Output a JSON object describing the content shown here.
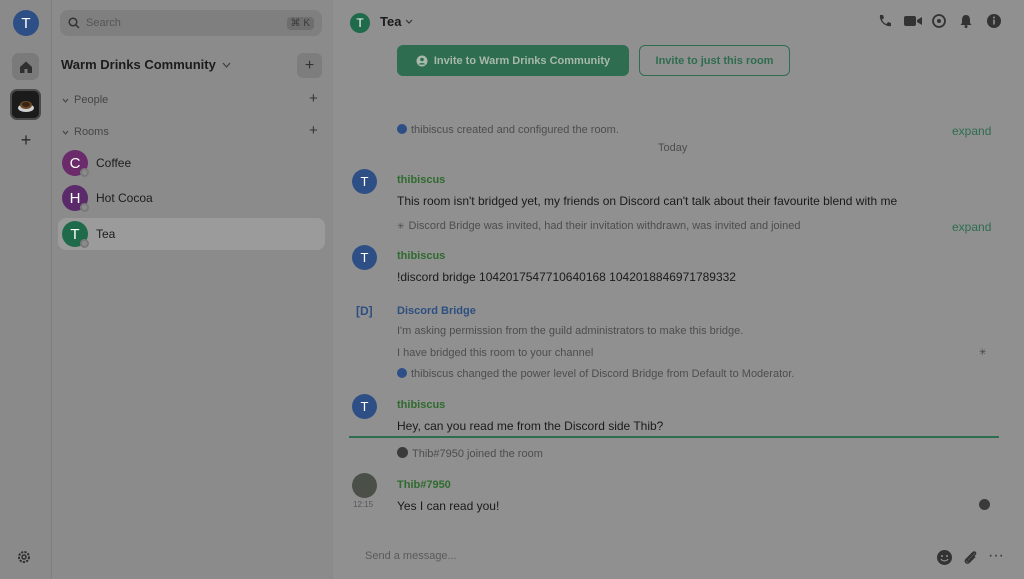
{
  "rail": {
    "user_initial": "T"
  },
  "search": {
    "placeholder": "Search",
    "shortcut": "⌘ K"
  },
  "space": {
    "name": "Warm Drinks Community"
  },
  "sections": {
    "people": "People",
    "rooms": "Rooms"
  },
  "rooms": [
    {
      "initial": "C",
      "name": "Coffee",
      "color": "#6b2a6a"
    },
    {
      "initial": "H",
      "name": "Hot Cocoa",
      "color": "#5a2a6a"
    },
    {
      "initial": "T",
      "name": "Tea",
      "color": "#1f6a4a"
    }
  ],
  "header": {
    "room_initial": "T",
    "room_name": "Tea"
  },
  "invite": {
    "space_label": "Invite to Warm Drinks Community",
    "room_label": "Invite to just this room"
  },
  "timeline": {
    "created_event": "thibiscus created and configured the room.",
    "expand_1": "expand",
    "date_sep": "Today",
    "msg1_sender": "thibiscus",
    "msg1_text": "This room isn't bridged yet, my friends on Discord can't talk about their favourite blend with me",
    "bridge_event": "Discord Bridge was invited, had their invitation withdrawn, was invited and joined",
    "expand_2": "expand",
    "msg2_sender": "thibiscus",
    "msg2_text": "!discord bridge 1042017547710640168 1042018846971789332",
    "bridge_avatar": "[D]",
    "bridge_sender": "Discord Bridge",
    "bridge_msg1": "I'm asking permission from the guild administrators to make this bridge.",
    "bridge_msg2": "I have bridged this room to your channel",
    "power_event": "thibiscus changed the power level of Discord Bridge from Default to Moderator.",
    "msg3_sender": "thibiscus",
    "msg3_text": "Hey, can you read me from the Discord side Thib?",
    "join_event": "Thib#7950 joined the room",
    "msg4_sender": "Thib#7950",
    "msg4_time": "12:15",
    "msg4_text": "Yes I can read you!"
  },
  "composer": {
    "placeholder": "Send a message..."
  }
}
